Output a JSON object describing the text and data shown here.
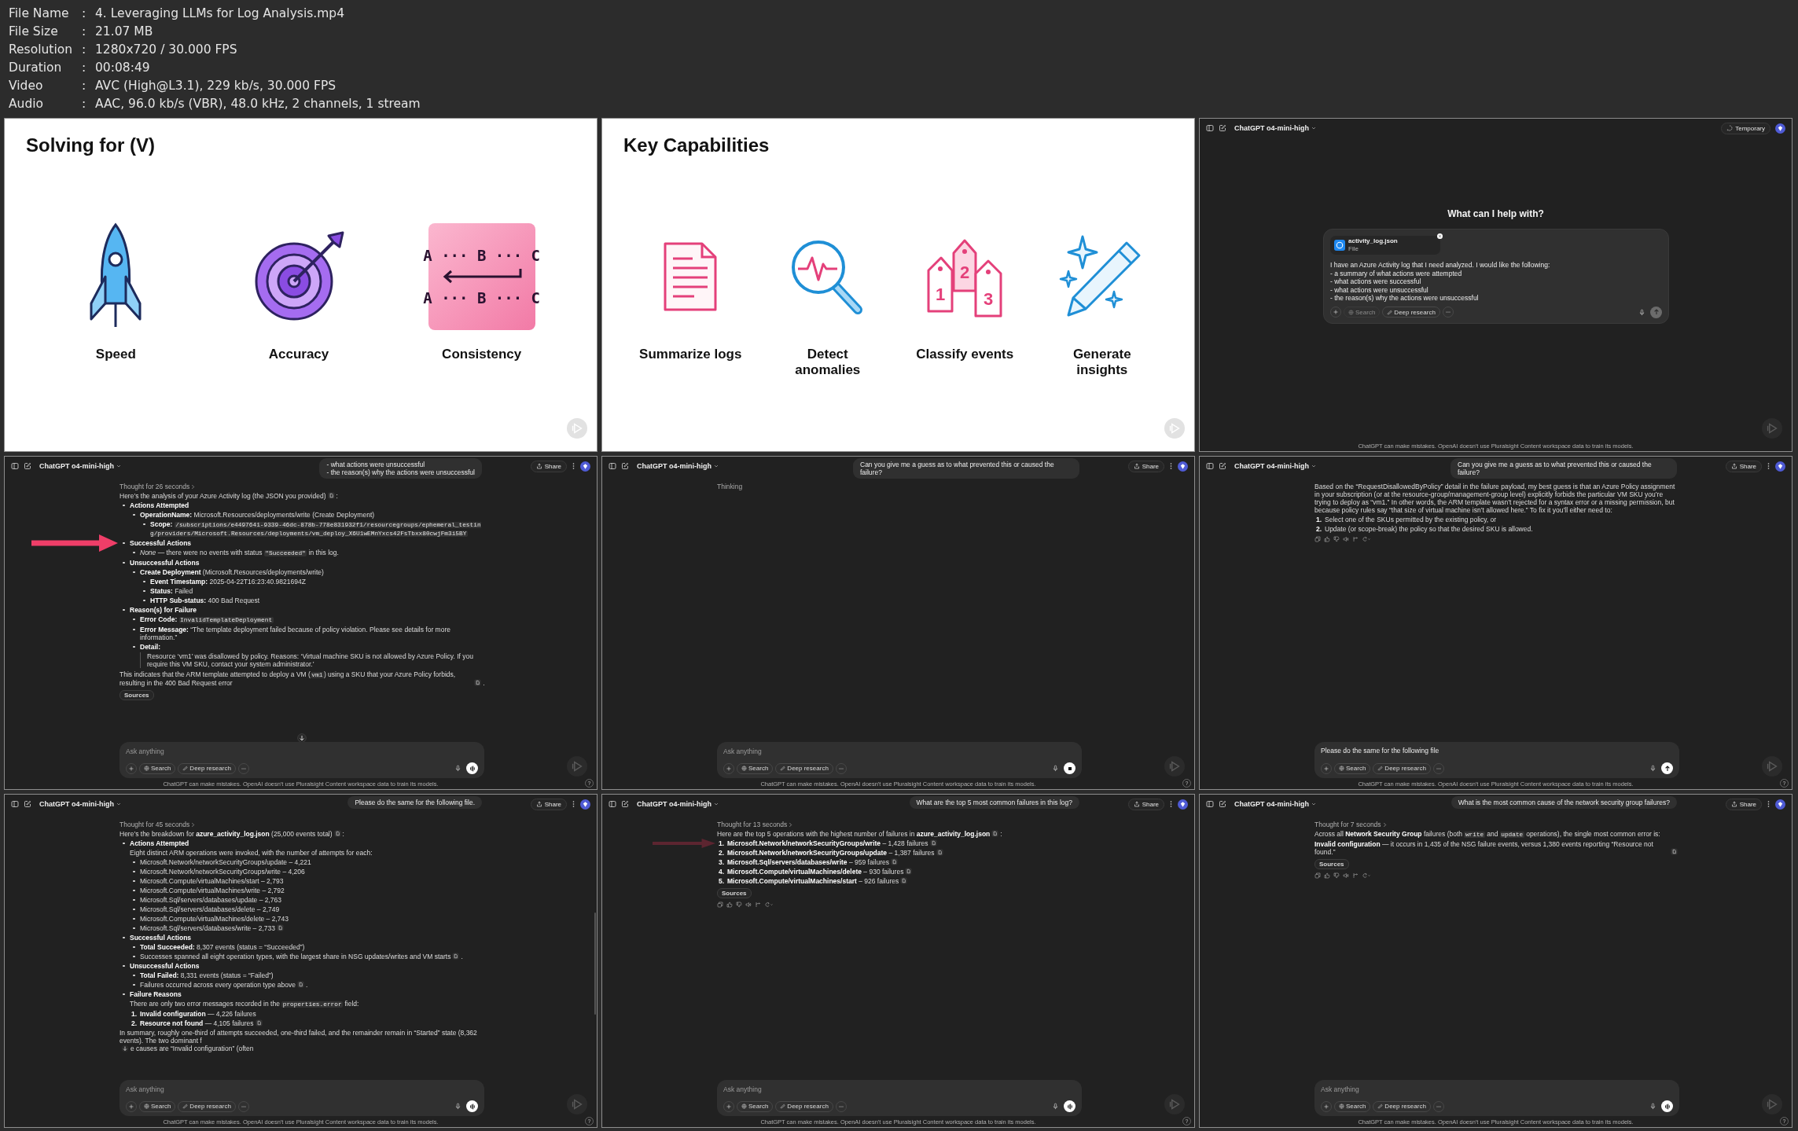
{
  "header": [
    {
      "label": "File Name",
      "sep": ":",
      "value": "4. Leveraging LLMs for Log Analysis.mp4"
    },
    {
      "label": "File Size",
      "sep": ":",
      "value": "21.07 MB"
    },
    {
      "label": "Resolution",
      "sep": ":",
      "value": "1280x720 / 30.000 FPS"
    },
    {
      "label": "Duration",
      "sep": ":",
      "value": "00:08:49"
    },
    {
      "label": "Video",
      "sep": ":",
      "value": "AVC (High@L3.1), 229 kb/s, 30.000 FPS"
    },
    {
      "label": "Audio",
      "sep": ":",
      "value": "AAC, 96.0 kb/s (VBR), 48.0 kHz, 2 channels, 1 stream"
    }
  ],
  "frames": [
    {
      "kind": "slide",
      "title": "Solving for (V)",
      "items": [
        {
          "label": "Speed",
          "kind": "rocket"
        },
        {
          "label": "Accuracy",
          "kind": "target"
        },
        {
          "label": "Consistency",
          "kind": "abc-card",
          "card_lines": [
            "A ··· B ··· C",
            "A ··· B ··· C"
          ]
        }
      ]
    },
    {
      "kind": "slide",
      "title": "Key Capabilities",
      "items": [
        {
          "label": "Summarize logs",
          "kind": "document"
        },
        {
          "label": "Detect anomalies",
          "kind": "magnifier"
        },
        {
          "label": "Classify events",
          "kind": "tags",
          "tag_numbers": [
            "1",
            "2",
            "3"
          ]
        },
        {
          "label": "Generate insights",
          "kind": "sparkle-pencil"
        }
      ]
    },
    {
      "kind": "chat",
      "model": "ChatGPT o4-mini-high",
      "top_action": {
        "kind": "temporary",
        "label": "Temporary"
      },
      "greeting": "What can I help with?",
      "composer": {
        "attachment": {
          "name": "activity_log.json",
          "type": "File"
        },
        "value": "I have an Azure Activity log that I need analyzed. I would like the following:\n- a summary of what actions were attempted\n- what actions were successful\n- what actions were unsuccessful\n- the reason(s) why the actions were unsuccessful",
        "search": "Search",
        "search_disabled": true,
        "deep": "Deep research",
        "send_button": {
          "kind": "send-disabled"
        }
      },
      "footer": "ChatGPT can make mistakes. OpenAI doesn't use Pluralsight Content workspace data to train its models."
    },
    {
      "kind": "chat",
      "model": "ChatGPT o4-mini-high",
      "top_action": {
        "kind": "share",
        "label": "Share"
      },
      "user_message": [
        "- what actions were unsuccessful",
        "- the reason(s) why the actions were unsuccessful"
      ],
      "blocks": [
        {
          "kind": "thought",
          "text": "Thought for 26 seconds"
        },
        {
          "kind": "para",
          "runs": [
            {
              "kind": "text",
              "text": "Here’s the analysis of your Azure Activity log (the JSON you provided)"
            },
            {
              "kind": "cite"
            },
            {
              "kind": "text",
              "text": ":"
            }
          ]
        },
        {
          "kind": "list",
          "items": [
            {
              "text": "**Actions Attempted**",
              "children": [
                {
                  "text": "**OperationName:** Microsoft.Resources/deployments/write (Create Deployment)",
                  "children": [
                    {
                      "runs": [
                        {
                          "kind": "text",
                          "text": "**Scope:** "
                        },
                        {
                          "kind": "code",
                          "text": "/subscriptions/e4497641-9339-46dc-878b-778e831932f1/resourcegroups/ephemeral_testing/providers/Microsoft.Resources/deployments/vm_deploy_X6U1wEMnYxcs42FsTbxx80cwjFm3i5BY"
                        }
                      ]
                    }
                  ]
                }
              ]
            },
            {
              "text": "**Successful Actions**",
              "arrow": {
                "kind": "bright"
              },
              "children": [
                {
                  "runs": [
                    {
                      "kind": "text",
                      "text": "*None* — there were no events with status "
                    },
                    {
                      "kind": "code",
                      "text": "\"Succeeded\""
                    },
                    {
                      "kind": "text",
                      "text": " in this log."
                    }
                  ]
                }
              ]
            },
            {
              "text": "**Unsuccessful Actions**",
              "children": [
                {
                  "text": "**Create Deployment** (Microsoft.Resources/deployments/write)",
                  "children": [
                    {
                      "text": "**Event Timestamp:** 2025-04-22T16:23:40.9821694Z"
                    },
                    {
                      "text": "**Status:** Failed"
                    },
                    {
                      "text": "**HTTP Sub-status:** 400 Bad Request"
                    }
                  ]
                }
              ]
            },
            {
              "text": "**Reason(s) for Failure**",
              "children": [
                {
                  "runs": [
                    {
                      "kind": "text",
                      "text": "**Error Code:** "
                    },
                    {
                      "kind": "code",
                      "text": "InvalidTemplateDeployment"
                    }
                  ]
                },
                {
                  "text": "**Error Message:** “The template deployment failed because of policy violation. Please see details for more information.”"
                },
                {
                  "text": "**Detail:**",
                  "quote": "Resource ‘vm1’ was disallowed by policy. Reasons: ‘Virtual machine SKU is not allowed by Azure Policy. If you require this VM SKU, contact your system administrator.’"
                }
              ],
              "after": [
                {
                  "kind": "text",
                  "text": "This indicates that the ARM template attempted to deploy a VM ("
                },
                {
                  "kind": "code",
                  "text": "vm1"
                },
                {
                  "kind": "text",
                  "text": ") using a SKU that your Azure Policy forbids, resulting in the 400 Bad Request error"
                },
                {
                  "kind": "cite"
                },
                {
                  "kind": "text",
                  "text": "."
                }
              ]
            }
          ]
        },
        {
          "kind": "sources",
          "label": "Sources"
        }
      ],
      "composer": {
        "placeholder": "Ask anything",
        "search": "Search",
        "search_disabled": false,
        "deep": "Deep research",
        "send_button": {
          "kind": "voice"
        },
        "scroll_button": true
      },
      "footer": "ChatGPT can make mistakes. OpenAI doesn't use Pluralsight Content workspace data to train its models.",
      "help": "?"
    },
    {
      "kind": "chat",
      "model": "ChatGPT o4-mini-high",
      "top_action": {
        "kind": "share",
        "label": "Share"
      },
      "user_message": [
        "Can you give me a guess as to what prevented this or caused the failure?"
      ],
      "blocks": [
        {
          "kind": "status",
          "text": "Thinking"
        }
      ],
      "composer": {
        "placeholder": "Ask anything",
        "search": "Search",
        "search_disabled": false,
        "deep": "Deep research",
        "send_button": {
          "kind": "stop"
        }
      },
      "footer": "ChatGPT can make mistakes. OpenAI doesn't use Pluralsight Content workspace data to train its models.",
      "help": "?"
    },
    {
      "kind": "chat",
      "model": "ChatGPT o4-mini-high",
      "top_action": {
        "kind": "share",
        "label": "Share"
      },
      "user_message": [
        "Can you give me a guess as to what prevented this or caused the failure?"
      ],
      "blocks": [
        {
          "kind": "para",
          "runs": [
            {
              "kind": "text",
              "text": "Based on the “RequestDisallowedByPolicy” detail in the failure payload, my best guess is that an Azure Policy assignment in your subscription (or at the resource-group/management-group level) explicitly forbids the particular VM SKU you’re trying to deploy as “vm1.” In other words, the ARM template wasn’t rejected for a syntax error or a missing permission, but because policy rules say “that size of virtual machine isn’t allowed here.” To fix it you’ll either need to:"
            }
          ]
        },
        {
          "kind": "list",
          "items": [
            {
              "number": "1.",
              "text": "Select one of the SKUs permitted by the existing policy, or"
            },
            {
              "number": "2.",
              "text": "Update (or scope-break) the policy so that the desired SKU is allowed."
            }
          ]
        },
        {
          "kind": "actions"
        }
      ],
      "composer": {
        "value": "Please do the same for the following file",
        "search": "Search",
        "search_disabled": false,
        "deep": "Deep research",
        "send_button": {
          "kind": "send"
        }
      },
      "footer": "ChatGPT can make mistakes. OpenAI doesn't use Pluralsight Content workspace data to train its models.",
      "help": "?"
    },
    {
      "kind": "chat",
      "model": "ChatGPT o4-mini-high",
      "top_action": {
        "kind": "share",
        "label": "Share"
      },
      "user_message": [
        "Please do the same for the following file."
      ],
      "scrollbar": true,
      "blocks": [
        {
          "kind": "thought",
          "text": "Thought for 45 seconds"
        },
        {
          "kind": "para",
          "runs": [
            {
              "kind": "text",
              "text": "Here’s the breakdown for **azure_activity_log.json** (25,000 events total)"
            },
            {
              "kind": "cite"
            },
            {
              "kind": "text",
              "text": ":"
            }
          ]
        },
        {
          "kind": "list",
          "items": [
            {
              "text": "**Actions Attempted**",
              "note": "Eight distinct ARM operations were invoked, with the number of attempts for each:",
              "children": [
                {
                  "text": "Microsoft.Network/networkSecurityGroups/update – 4,221"
                },
                {
                  "text": "Microsoft.Network/networkSecurityGroups/write – 4,206"
                },
                {
                  "text": "Microsoft.Compute/virtualMachines/start – 2,793"
                },
                {
                  "text": "Microsoft.Compute/virtualMachines/write – 2,792"
                },
                {
                  "text": "Microsoft.Sql/servers/databases/update – 2,763"
                },
                {
                  "text": "Microsoft.Sql/servers/databases/delete – 2,749"
                },
                {
                  "text": "Microsoft.Compute/virtualMachines/delete – 2,743"
                },
                {
                  "runs": [
                    {
                      "kind": "text",
                      "text": "Microsoft.Sql/servers/databases/write – 2,733"
                    },
                    {
                      "kind": "cite"
                    }
                  ]
                }
              ]
            },
            {
              "text": "**Successful Actions**",
              "children": [
                {
                  "text": "**Total Succeeded:** 8,307 events (status = “Succeeded”)"
                },
                {
                  "runs": [
                    {
                      "kind": "text",
                      "text": "Successes spanned all eight operation types, with the largest share in NSG updates/writes and VM starts"
                    },
                    {
                      "kind": "cite"
                    },
                    {
                      "kind": "text",
                      "text": "."
                    }
                  ]
                }
              ]
            },
            {
              "text": "**Unsuccessful Actions**",
              "children": [
                {
                  "text": "**Total Failed:** 8,331 events (status = “Failed”)"
                },
                {
                  "runs": [
                    {
                      "kind": "text",
                      "text": "Failures occurred across every operation type above"
                    },
                    {
                      "kind": "cite"
                    },
                    {
                      "kind": "text",
                      "text": "."
                    }
                  ]
                }
              ]
            },
            {
              "text": "**Failure Reasons**",
              "note": [
                {
                  "kind": "text",
                  "text": "There are only two error messages recorded in the "
                },
                {
                  "kind": "code",
                  "text": "properties.error"
                },
                {
                  "kind": "text",
                  "text": " field:"
                }
              ],
              "children": [
                {
                  "number": "1.",
                  "text": "**Invalid configuration** — 4,226 failures"
                },
                {
                  "number": "2.",
                  "runs": [
                    {
                      "kind": "text",
                      "text": "**Resource not found** — 4,105 failures"
                    },
                    {
                      "kind": "cite"
                    }
                  ]
                }
              ]
            }
          ]
        },
        {
          "kind": "para",
          "runs": [
            {
              "kind": "text",
              "text": "In summary, roughly one-third of attempts succeeded, one-third failed, and the remainder remain in “Started” state (8,362 events). The two dominant f"
            },
            {
              "kind": "scroll-arrow"
            },
            {
              "kind": "text",
              "text": "e causes are “Invalid configuration” (often"
            }
          ]
        }
      ],
      "composer": {
        "placeholder": "Ask anything",
        "search": "Search",
        "search_disabled": false,
        "deep": "Deep research",
        "send_button": {
          "kind": "voice"
        }
      },
      "footer": "ChatGPT can make mistakes. OpenAI doesn't use Pluralsight Content workspace data to train its models.",
      "help": "?"
    },
    {
      "kind": "chat",
      "model": "ChatGPT o4-mini-high",
      "top_action": {
        "kind": "share",
        "label": "Share"
      },
      "user_message": [
        "What are the top 5 most common failures in this log?"
      ],
      "blocks": [
        {
          "kind": "thought",
          "text": "Thought for 13 seconds"
        },
        {
          "kind": "para",
          "runs": [
            {
              "kind": "text",
              "text": "Here are the top 5 operations with the highest number of failures in **azure_activity_log.json**"
            },
            {
              "kind": "cite"
            },
            {
              "kind": "text",
              "text": ":"
            }
          ]
        },
        {
          "kind": "list",
          "items": [
            {
              "number": "1.",
              "arrow": {
                "kind": "faded"
              },
              "runs": [
                {
                  "kind": "text",
                  "text": "**Microsoft.Network/networkSecurityGroups/write** – 1,428 failures"
                },
                {
                  "kind": "cite"
                }
              ]
            },
            {
              "number": "2.",
              "runs": [
                {
                  "kind": "text",
                  "text": "**Microsoft.Network/networkSecurityGroups/update** – 1,387 failures"
                },
                {
                  "kind": "cite"
                }
              ]
            },
            {
              "number": "3.",
              "runs": [
                {
                  "kind": "text",
                  "text": "**Microsoft.Sql/servers/databases/write** – 959 failures"
                },
                {
                  "kind": "cite"
                }
              ]
            },
            {
              "number": "4.",
              "runs": [
                {
                  "kind": "text",
                  "text": "**Microsoft.Compute/virtualMachines/delete** – 930 failures"
                },
                {
                  "kind": "cite"
                }
              ]
            },
            {
              "number": "5.",
              "runs": [
                {
                  "kind": "text",
                  "text": "**Microsoft.Compute/virtualMachines/start** – 926 failures"
                },
                {
                  "kind": "cite"
                }
              ]
            }
          ]
        },
        {
          "kind": "sources",
          "label": "Sources"
        },
        {
          "kind": "actions"
        }
      ],
      "composer": {
        "placeholder": "Ask anything",
        "search": "Search",
        "search_disabled": false,
        "deep": "Deep research",
        "send_button": {
          "kind": "voice"
        }
      },
      "footer": "ChatGPT can make mistakes. OpenAI doesn't use Pluralsight Content workspace data to train its models.",
      "help": "?"
    },
    {
      "kind": "chat",
      "model": "ChatGPT o4-mini-high",
      "top_action": {
        "kind": "share",
        "label": "Share"
      },
      "user_message": [
        "What is the most common cause of the network security group failures?"
      ],
      "blocks": [
        {
          "kind": "thought",
          "text": "Thought for 7 seconds"
        },
        {
          "kind": "para",
          "runs": [
            {
              "kind": "text",
              "text": "Across all **Network Security Group** failures (both "
            },
            {
              "kind": "code",
              "text": "write"
            },
            {
              "kind": "text",
              "text": " and "
            },
            {
              "kind": "code",
              "text": "update"
            },
            {
              "kind": "text",
              "text": " operations), the single most common error is:"
            }
          ]
        },
        {
          "kind": "para",
          "runs": [
            {
              "kind": "text",
              "text": "**Invalid configuration** — it occurs in 1,435 of the NSG failure events, versus 1,380 events reporting “Resource not found.”"
            },
            {
              "kind": "cite"
            }
          ]
        },
        {
          "kind": "sources",
          "label": "Sources"
        },
        {
          "kind": "actions"
        }
      ],
      "composer": {
        "placeholder": "Ask anything",
        "search": "Search",
        "search_disabled": false,
        "deep": "Deep research",
        "send_button": {
          "kind": "voice"
        }
      },
      "footer": "ChatGPT can make mistakes. OpenAI doesn't use Pluralsight Content workspace data to train its models.",
      "help": "?"
    }
  ]
}
